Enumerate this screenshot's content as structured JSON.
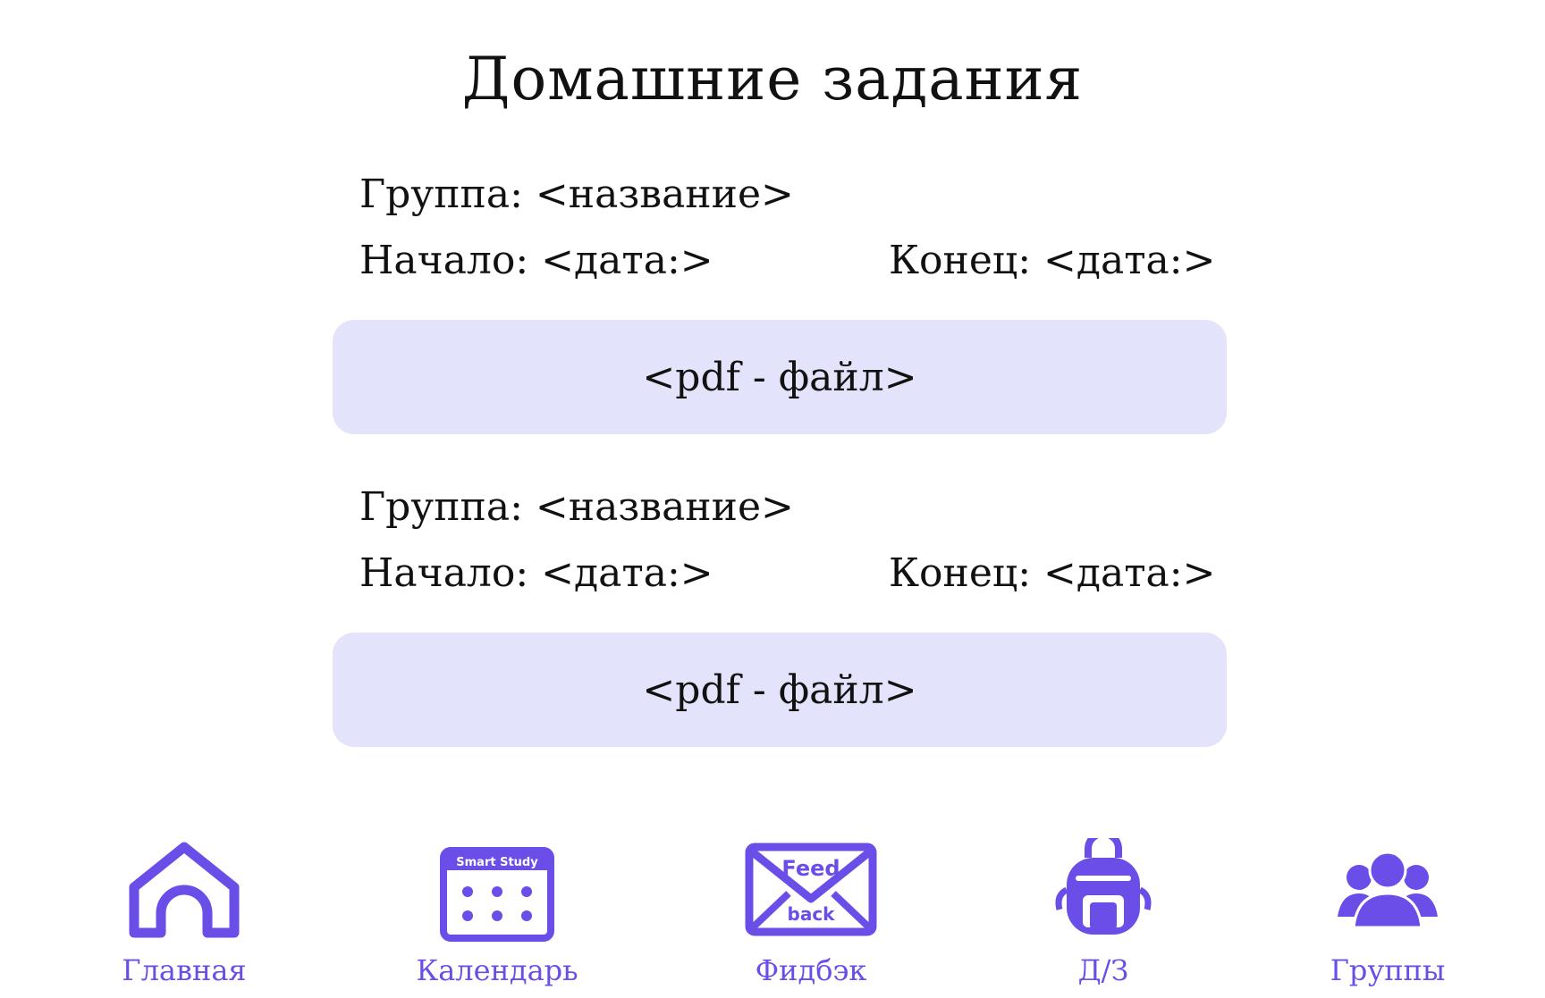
{
  "page": {
    "title": "Домашние задания"
  },
  "assignments": [
    {
      "group_label": "Группа: <название>",
      "start_label": "Начало: <дата:>",
      "end_label": "Конец: <дата:>",
      "file_label": "<pdf - файл>"
    },
    {
      "group_label": "Группа: <название>",
      "start_label": "Начало: <дата:>",
      "end_label": "Конец: <дата:>",
      "file_label": "<pdf - файл>"
    }
  ],
  "nav": {
    "accent_color": "#6b4ee8",
    "items": [
      {
        "label": "Главная",
        "icon": "house-icon"
      },
      {
        "label": "Календарь",
        "icon": "calendar-icon",
        "icon_text": "Smart Study"
      },
      {
        "label": "Фидбэк",
        "icon": "envelope-icon",
        "icon_text_top": "Feed",
        "icon_text_bottom": "back"
      },
      {
        "label": "Д/З",
        "icon": "backpack-icon"
      },
      {
        "label": "Группы",
        "icon": "people-group-icon"
      }
    ]
  },
  "colors": {
    "file_box_bg": "#e3e3fc",
    "text": "#111111"
  }
}
